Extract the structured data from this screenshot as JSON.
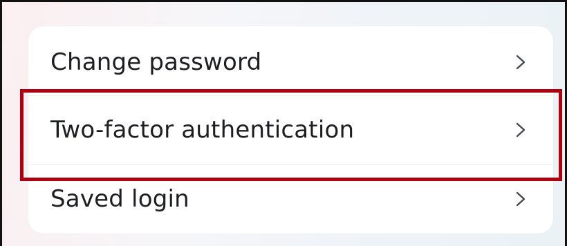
{
  "settings_list": {
    "items": [
      {
        "label": "Change password",
        "chevron_icon": "chevron-right-icon"
      },
      {
        "label": "Two-factor authentication",
        "chevron_icon": "chevron-right-icon"
      },
      {
        "label": "Saved login",
        "chevron_icon": "chevron-right-icon"
      }
    ]
  },
  "highlight": {
    "color": "#b00010",
    "target": "Two-factor authentication"
  },
  "colors": {
    "text": "#1c1e21",
    "chevron": "#444950",
    "card": "#ffffff"
  }
}
